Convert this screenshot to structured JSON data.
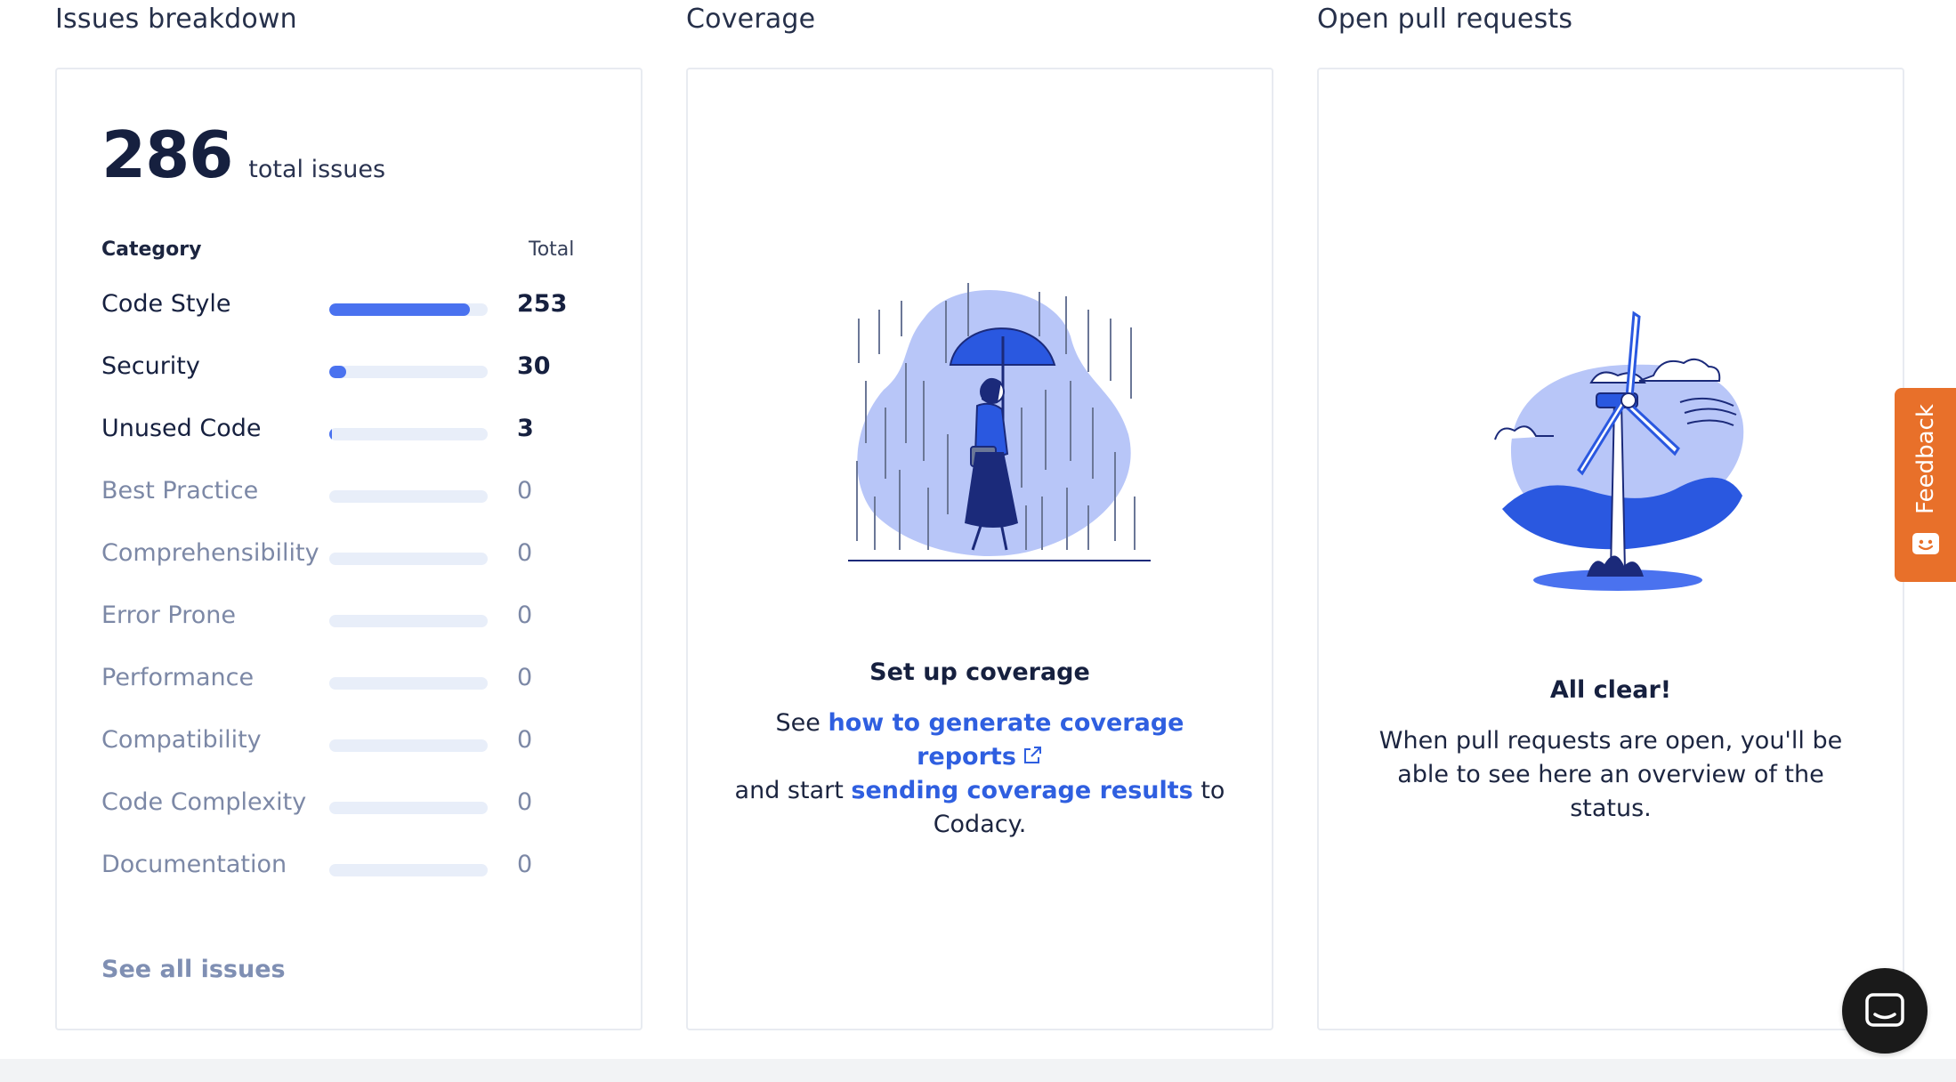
{
  "sections": {
    "issues_title": "Issues breakdown",
    "coverage_title": "Coverage",
    "pulls_title": "Open pull requests"
  },
  "issues": {
    "total": "286",
    "total_label": "total issues",
    "header_category": "Category",
    "header_total": "Total",
    "categories": [
      {
        "name": "Code Style",
        "value": "253",
        "fraction": 0.885
      },
      {
        "name": "Security",
        "value": "30",
        "fraction": 0.105
      },
      {
        "name": "Unused Code",
        "value": "3",
        "fraction": 0.01
      },
      {
        "name": "Best Practice",
        "value": "0",
        "fraction": 0
      },
      {
        "name": "Comprehensibility",
        "value": "0",
        "fraction": 0
      },
      {
        "name": "Error Prone",
        "value": "0",
        "fraction": 0
      },
      {
        "name": "Performance",
        "value": "0",
        "fraction": 0
      },
      {
        "name": "Compatibility",
        "value": "0",
        "fraction": 0
      },
      {
        "name": "Code Complexity",
        "value": "0",
        "fraction": 0
      },
      {
        "name": "Documentation",
        "value": "0",
        "fraction": 0
      }
    ],
    "see_all": "See all issues"
  },
  "coverage": {
    "title": "Set up coverage",
    "text_see": "See",
    "link_generate": "how to generate coverage reports",
    "text_and_start": "and start",
    "link_sending": "sending coverage results",
    "text_to": "to",
    "text_codacy": "Codacy."
  },
  "pulls": {
    "title": "All clear!",
    "text": "When pull requests are open, you'll be able to see here an overview of the status."
  },
  "feedback": {
    "label": "Feedback"
  },
  "colors": {
    "accent": "#4a72ef",
    "link": "#2f5fe0",
    "feedback_bg": "#e8702a",
    "illustration_blob": "#b8c6f8",
    "illustration_dark": "#1b2a7a"
  },
  "icons": {
    "external_link": "external-link-icon",
    "feedback": "smiley-face-icon",
    "chat": "chat-bubble-icon"
  }
}
